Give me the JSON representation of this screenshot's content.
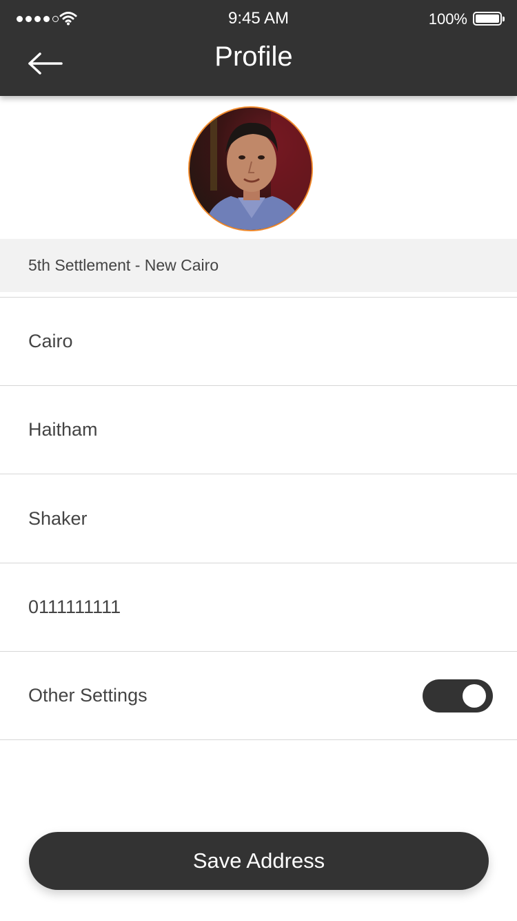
{
  "status_bar": {
    "time": "9:45 AM",
    "battery_text": "100%",
    "signal_bars": 4,
    "signal_total": 5
  },
  "header": {
    "title": "Profile",
    "back_icon": "arrow-left-icon"
  },
  "profile": {
    "avatar_icon": "user-avatar-photo",
    "accent_color": "#f08a2c"
  },
  "address": "5th Settlement - New Cairo",
  "fields": {
    "city": "Cairo",
    "first_name": "Haitham",
    "last_name": "Shaker",
    "phone": "0111111111"
  },
  "settings": {
    "label": "Other Settings",
    "toggle_on": true
  },
  "actions": {
    "save_label": "Save Address"
  },
  "colors": {
    "header_bg": "#333333",
    "button_bg": "#333333",
    "address_bg": "#f2f2f2"
  }
}
